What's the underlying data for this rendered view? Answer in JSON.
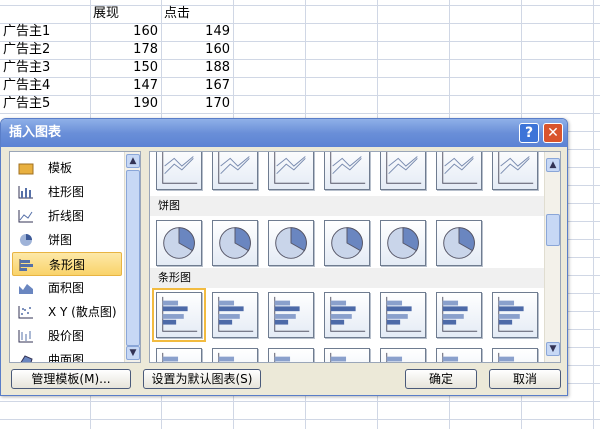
{
  "sheet": {
    "headers": [
      "展现",
      "点击"
    ],
    "rows": [
      {
        "name": "广告主1",
        "impressions": "160",
        "clicks": "149"
      },
      {
        "name": "广告主2",
        "impressions": "178",
        "clicks": "160"
      },
      {
        "name": "广告主3",
        "impressions": "150",
        "clicks": "188"
      },
      {
        "name": "广告主4",
        "impressions": "147",
        "clicks": "167"
      },
      {
        "name": "广告主5",
        "impressions": "190",
        "clicks": "170"
      }
    ]
  },
  "dialog": {
    "title": "插入图表",
    "help": "?",
    "close": "✕",
    "categories": [
      {
        "label": "模板",
        "icon": "folder-icon"
      },
      {
        "label": "柱形图",
        "icon": "column-chart-icon"
      },
      {
        "label": "折线图",
        "icon": "line-chart-icon"
      },
      {
        "label": "饼图",
        "icon": "pie-chart-icon"
      },
      {
        "label": "条形图",
        "icon": "bar-chart-icon",
        "selected": true
      },
      {
        "label": "面积图",
        "icon": "area-chart-icon"
      },
      {
        "label": "X Y (散点图)",
        "icon": "scatter-chart-icon"
      },
      {
        "label": "股价图",
        "icon": "stock-chart-icon"
      },
      {
        "label": "曲面图",
        "icon": "surface-chart-icon"
      }
    ],
    "sections": {
      "pie": "饼图",
      "bar": "条形图"
    },
    "buttons": {
      "manage": "管理模板(M)...",
      "set_default": "设置为默认图表(S)",
      "ok": "确定",
      "cancel": "取消"
    }
  }
}
